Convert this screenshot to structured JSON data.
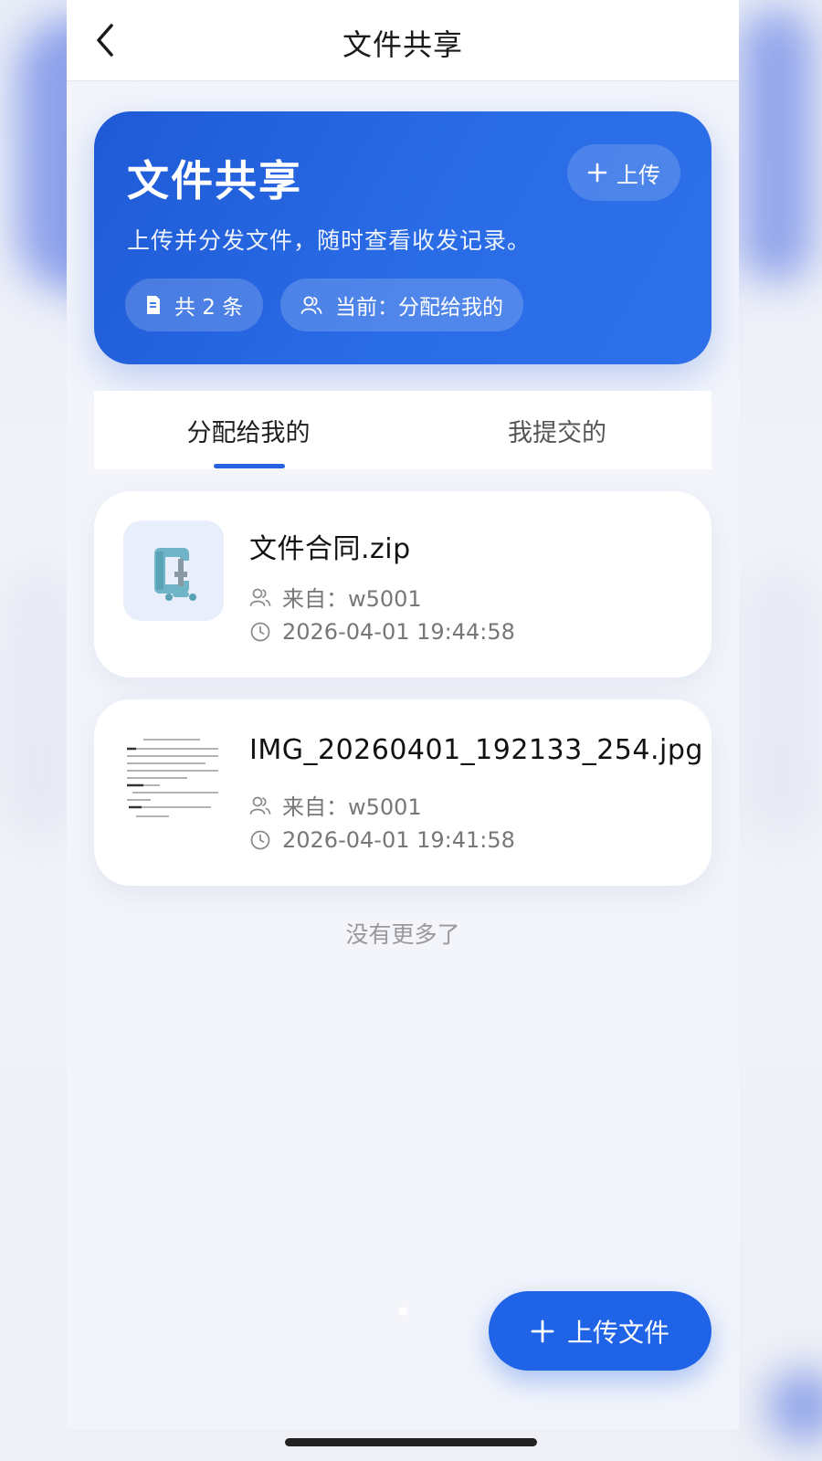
{
  "navbar": {
    "title": "文件共享",
    "back_icon": "chevron-left-icon"
  },
  "hero": {
    "title": "文件共享",
    "subtitle": "上传并分发文件，随时查看收发记录。",
    "upload_label": "上传",
    "count_label": "共 2 条",
    "current_label": "当前：分配给我的"
  },
  "tabs": {
    "items": [
      {
        "label": "分配给我的",
        "active": true
      },
      {
        "label": "我提交的",
        "active": false
      }
    ],
    "accent_color": "#2563e0"
  },
  "files": [
    {
      "name": "文件合同.zip",
      "from": "来自：w5001",
      "time": "2026-04-01 19:44:58",
      "thumb": "archive-clamp-icon"
    },
    {
      "name": "IMG_20260401_192133_254.jpg",
      "from": "来自：w5001",
      "time": "2026-04-01 19:41:58",
      "thumb": "document-image-thumbnail"
    }
  ],
  "list_footer": "没有更多了",
  "fab": {
    "label": "上传文件"
  },
  "colors": {
    "brand": "#1f63e6",
    "hero_gradient_start": "#1f5ad6",
    "hero_gradient_end": "#2d70ea"
  }
}
